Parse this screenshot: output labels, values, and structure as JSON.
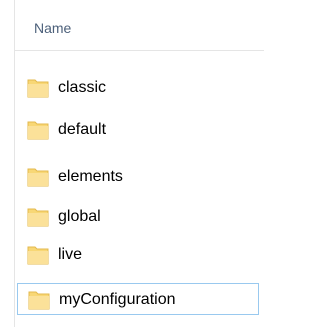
{
  "header": {
    "column_name": "Name"
  },
  "folders": [
    {
      "label": "classic"
    },
    {
      "label": "default"
    },
    {
      "label": "elements"
    },
    {
      "label": "global"
    },
    {
      "label": "live"
    },
    {
      "label": "myConfiguration"
    }
  ],
  "selected_index": 5,
  "colors": {
    "folder_fill": "#f8d775",
    "folder_edge": "#e3b94d",
    "selection_border": "#99c9ef",
    "header_text": "#4c607a"
  },
  "icons": {
    "folder": "folder-icon"
  }
}
